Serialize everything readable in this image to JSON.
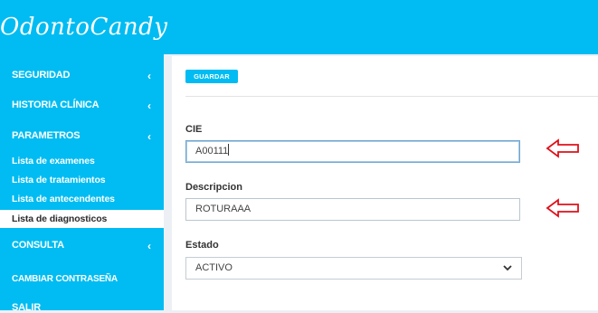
{
  "app": {
    "logo_text": "OdontoCandy"
  },
  "sidebar": {
    "items": [
      {
        "label": "SEGURIDAD",
        "chevron": "‹"
      },
      {
        "label": "HISTORIA CLÍNICA",
        "chevron": "‹"
      },
      {
        "label": "PARAMETROS",
        "chevron": "‹"
      }
    ],
    "submenu": [
      {
        "label": "Lista de examenes"
      },
      {
        "label": "Lista de tratamientos"
      },
      {
        "label": "Lista de antecendentes"
      },
      {
        "label": "Lista de diagnosticos",
        "active": true
      }
    ],
    "bottom_items": [
      {
        "label": "CONSULTA",
        "chevron": "‹"
      },
      {
        "label": "CAMBIAR CONTRASEÑA"
      },
      {
        "label": "SALIR"
      }
    ]
  },
  "form": {
    "save_label": "GUARDAR",
    "cie_label": "CIE",
    "cie_value": "A00111",
    "descripcion_label": "Descripcion",
    "descripcion_value": "ROTURAAA",
    "estado_label": "Estado",
    "estado_value": "ACTIVO"
  },
  "colors": {
    "primary": "#00bcf2",
    "arrow": "#e0101a"
  }
}
